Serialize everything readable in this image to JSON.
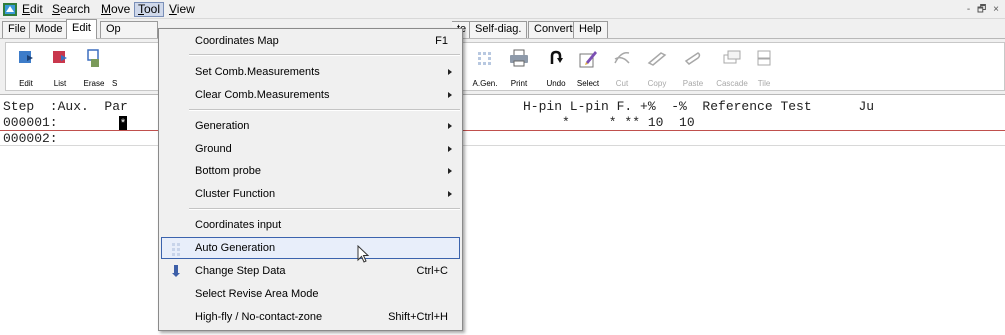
{
  "menubar": {
    "items": [
      {
        "label": "Edit",
        "ul": "E"
      },
      {
        "label": "Search",
        "ul": "S"
      },
      {
        "label": "Move",
        "ul": "M"
      },
      {
        "label": "Tool",
        "ul": "T"
      },
      {
        "label": "View",
        "ul": "V"
      }
    ],
    "window_controls": "- 🗗 ×"
  },
  "tabs": [
    "File",
    "Mode",
    "Edit",
    "Op",
    "te",
    "Self-diag.",
    "Convert",
    "Help"
  ],
  "toolbar": {
    "left": [
      "Edit",
      "List",
      "Erase",
      "S"
    ],
    "right": [
      "A.Gen.",
      "Print",
      "Undo",
      "Select",
      "Cut",
      "Copy",
      "Paste",
      "Cascade",
      "Tile"
    ]
  },
  "grid": {
    "header_left": "Step  :Aux.  Par",
    "header_right": "H-pin L-pin F. +%  -%  Reference Test      Ju",
    "rows": [
      {
        "step": "000001:",
        "cursor": "*",
        "right": "*     * ** 10  10"
      },
      {
        "step": "000002:",
        "cursor": "",
        "right": ""
      }
    ]
  },
  "menu": {
    "items": [
      {
        "label": "Coordinates Map",
        "accel": "F1",
        "submenu": false
      },
      {
        "label": "Set Comb.Measurements",
        "accel": "",
        "submenu": true
      },
      {
        "label": "Clear Comb.Measurements",
        "accel": "",
        "submenu": true
      },
      {
        "label": "Generation",
        "accel": "",
        "submenu": true
      },
      {
        "label": "Ground",
        "accel": "",
        "submenu": true
      },
      {
        "label": "Bottom probe",
        "accel": "",
        "submenu": true
      },
      {
        "label": "Cluster Function",
        "accel": "",
        "submenu": true
      },
      {
        "label": "Coordinates input",
        "accel": "",
        "submenu": false
      },
      {
        "label": "Auto Generation",
        "accel": "",
        "submenu": false,
        "highlighted": true
      },
      {
        "label": "Change Step Data",
        "accel": "Ctrl+C",
        "submenu": false
      },
      {
        "label": "Select Revise Area Mode",
        "accel": "",
        "submenu": false
      },
      {
        "label": "High-fly / No-contact-zone",
        "accel": "Shift+Ctrl+H",
        "submenu": false
      }
    ]
  },
  "colors": {
    "accent": "#3b63ad",
    "row_line": "#c0504d"
  }
}
